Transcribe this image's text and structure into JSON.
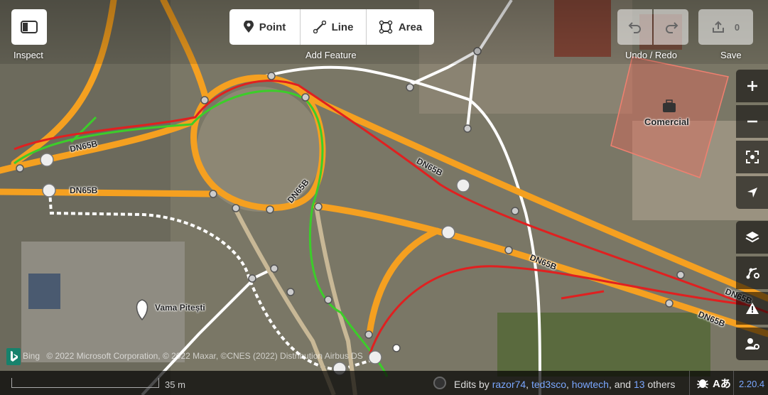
{
  "toolbar": {
    "inspect_label": "Inspect",
    "add_feature_label": "Add Feature",
    "point_label": "Point",
    "line_label": "Line",
    "area_label": "Area",
    "undo_redo_label": "Undo / Redo",
    "save_label": "Save",
    "save_count": "0"
  },
  "map": {
    "road_labels": [
      "DN65B",
      "DN65B",
      "DN65B",
      "DN65B",
      "DN65B",
      "DN65B",
      "DN65B"
    ],
    "poi_vama": "Vama Pitești",
    "poi_comercial": "Comercial",
    "attribution_brand": "Bing",
    "attribution_text": "© 2022 Microsoft Corporation, © 2022 Maxar, ©CNES (2022) Distribution Airbus DS"
  },
  "footer": {
    "scale_label": "35 m",
    "edits_prefix": "Edits by",
    "editor_1": "razor74",
    "editor_2": "ted3sco",
    "editor_3": "howtech",
    "and_text": ", and",
    "others_count": "13",
    "others_text": "others",
    "version": "2.20.4"
  },
  "icons": {
    "inspect": "sidebar-toggle-icon",
    "point": "pin-icon",
    "line": "line-icon",
    "area": "area-icon",
    "undo": "undo-icon",
    "redo": "redo-icon",
    "save": "upload-icon",
    "zoom_in": "plus-icon",
    "zoom_out": "minus-icon",
    "zoom_to": "focus-icon",
    "locate": "location-arrow-icon",
    "layers": "layers-icon",
    "map_data": "map-data-icon",
    "issues": "warning-icon",
    "preferences": "user-settings-icon",
    "help": "bug-icon",
    "language": "language-icon"
  },
  "colors": {
    "primary_road": "#f5a020",
    "footway": "#ffffff",
    "track": "#c8b896",
    "gps_green": "#3ccd2a",
    "gps_red": "#e02020",
    "building": "#e06a5a",
    "link": "#7aa7ff"
  }
}
